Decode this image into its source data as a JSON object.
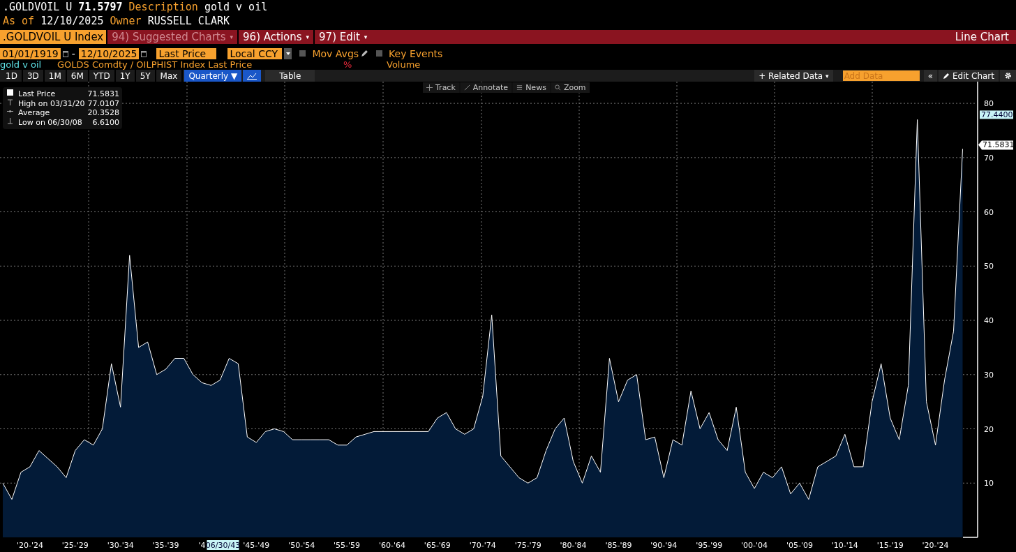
{
  "header": {
    "ticker": ".GOLDVOIL U",
    "price": "71.5797",
    "description_label": "Description",
    "description": "gold v oil",
    "as_of_label": "As of",
    "as_of": "12/10/2025",
    "owner_label": "Owner",
    "owner": "RUSSELL CLARK"
  },
  "menu_bar": {
    "security": ".GOLDVOIL U Index",
    "items": [
      {
        "label": "94) Suggested Charts",
        "caret": "▾",
        "disabled": true
      },
      {
        "label": "96) Actions",
        "caret": "▾",
        "disabled": false
      },
      {
        "label": "97) Edit",
        "caret": "▾",
        "disabled": false
      }
    ],
    "chart_type": "Line Chart"
  },
  "settings": {
    "start_date": "01/01/1919",
    "separator": "-",
    "end_date": "12/10/2025",
    "field": "Last Price",
    "currency": "Local CCY",
    "options": [
      {
        "label": "Mov Avgs",
        "checked": false
      },
      {
        "label": "Key Events",
        "checked": false
      }
    ]
  },
  "series_row": {
    "formula": "GOLDS Comdty / OILPHIST Index Last Price",
    "percent": "%",
    "volume": "Volume"
  },
  "toolbar": {
    "ranges": [
      {
        "label": "1D",
        "selected": false
      },
      {
        "label": "3D",
        "selected": false
      },
      {
        "label": "1M",
        "selected": false
      },
      {
        "label": "6M",
        "selected": false
      },
      {
        "label": "YTD",
        "selected": false
      },
      {
        "label": "1Y",
        "selected": false
      },
      {
        "label": "5Y",
        "selected": false
      },
      {
        "label": "Max",
        "selected": false
      }
    ],
    "frequency": "Quarterly ▼",
    "table": "Table",
    "related": "+ Related Data",
    "related_caret": "▾",
    "add_data_placeholder": "Add Data",
    "collapse": "«",
    "edit_chart": "Edit Chart"
  },
  "chart_tools": [
    "Track",
    "Annotate",
    "News",
    "Zoom"
  ],
  "legend": [
    {
      "label": "Last Price",
      "value": "71.5831",
      "kind": "last"
    },
    {
      "label": "High on 03/31/20",
      "value": "77.0107",
      "kind": "high"
    },
    {
      "label": "Average",
      "value": "20.3528",
      "kind": "average"
    },
    {
      "label": "Low on 06/30/08",
      "value": "6.6100",
      "kind": "low"
    }
  ],
  "chart": {
    "chart_data": {
      "type": "area",
      "categories": [
        null,
        null,
        null,
        "'20-'24",
        null,
        null,
        null,
        null,
        "'25-'29",
        null,
        null,
        null,
        null,
        "'30-'34",
        null,
        null,
        null,
        null,
        "'35-'39",
        null,
        null,
        null,
        "'4",
        null,
        null,
        null,
        null,
        null,
        "'45-'49",
        null,
        null,
        null,
        null,
        "'50-'54",
        null,
        null,
        null,
        null,
        "'55-'59",
        null,
        null,
        null,
        null,
        "'60-'64",
        null,
        null,
        null,
        null,
        "'65-'69",
        null,
        null,
        null,
        null,
        "'70-'74",
        null,
        null,
        null,
        null,
        "'75-'79",
        null,
        null,
        null,
        null,
        "'80-'84",
        null,
        null,
        null,
        null,
        "'85-'89",
        null,
        null,
        null,
        null,
        "'90-'94",
        null,
        null,
        null,
        null,
        "'95-'99",
        null,
        null,
        null,
        null,
        "'00-'04",
        null,
        null,
        null,
        null,
        "'05-'09",
        null,
        null,
        null,
        null,
        "'10-'14",
        null,
        null,
        null,
        null,
        "'15-'19",
        null,
        null,
        null,
        null,
        "'20-'24",
        null,
        null,
        null
      ],
      "series": [
        {
          "name": "gold v oil",
          "color": "#ffffff",
          "values": [
            10,
            7,
            12,
            13,
            16,
            14.5,
            13,
            11,
            16,
            18,
            17,
            20,
            32,
            24,
            52,
            35,
            36,
            30,
            31,
            33,
            33,
            30,
            28.5,
            28,
            29,
            33,
            32,
            18.5,
            17.5,
            19.5,
            20,
            19.5,
            18,
            18,
            18,
            18,
            18,
            17,
            17,
            18.5,
            19,
            19.5,
            19.5,
            19.5,
            19.5,
            19.5,
            19.5,
            19.5,
            22,
            23,
            20,
            19,
            20,
            26,
            41,
            15,
            13,
            11,
            10,
            11,
            16,
            20,
            22,
            14,
            10,
            15,
            12,
            33,
            25,
            29,
            30,
            18,
            18.5,
            11,
            18,
            17,
            27,
            20,
            23,
            18,
            16,
            24,
            12,
            9,
            12,
            11,
            13,
            8,
            10,
            7,
            13,
            14,
            15,
            19,
            13,
            13,
            25,
            32,
            22,
            18,
            28,
            77,
            25,
            17,
            29,
            38,
            71.6
          ]
        }
      ],
      "yticks": [
        10,
        20,
        30,
        40,
        50,
        60,
        70,
        80
      ],
      "ylim": [
        0,
        84
      ],
      "grid": true,
      "annotations": [
        "77.4400",
        "71.5831",
        "06/30/43"
      ]
    }
  }
}
